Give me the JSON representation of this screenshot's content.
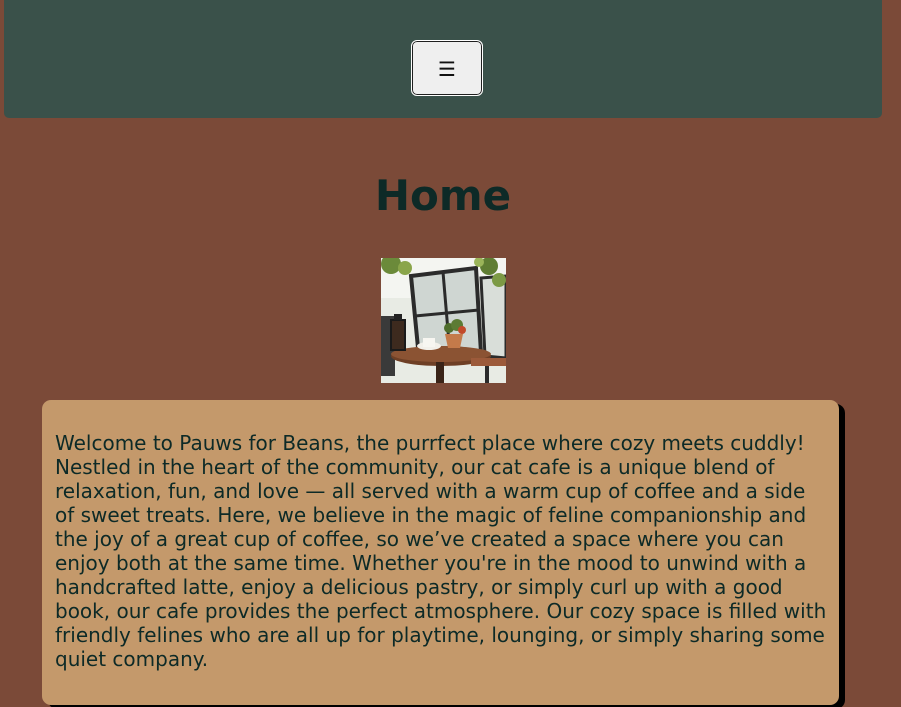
{
  "header": {
    "menu_button": {
      "label": "☰",
      "icon": "hamburger-menu-icon"
    }
  },
  "main": {
    "title": "Home",
    "welcome_text": "Welcome to Pauws for Beans, the purrfect place where cozy meets cuddly! Nestled in the heart of the community, our cat cafe is a unique blend of relaxation, fun, and love — all served with a warm cup of coffee and a side of sweet treats. Here, we believe in the magic of feline companionship and the joy of a great cup of coffee, so we’ve created a space where you can enjoy both at the same time. Whether you're in the mood to unwind with a handcrafted latte, enjoy a delicious pastry, or simply curl up with a good book, our cafe provides the perfect atmosphere. Our cozy space is filled with friendly felines who are all up for playtime, lounging, or simply sharing some quiet company."
  },
  "colors": {
    "page_background": "#7b4a38",
    "header_background": "#3a514a",
    "card_background": "#c4996b",
    "text": "#0d2a27"
  }
}
